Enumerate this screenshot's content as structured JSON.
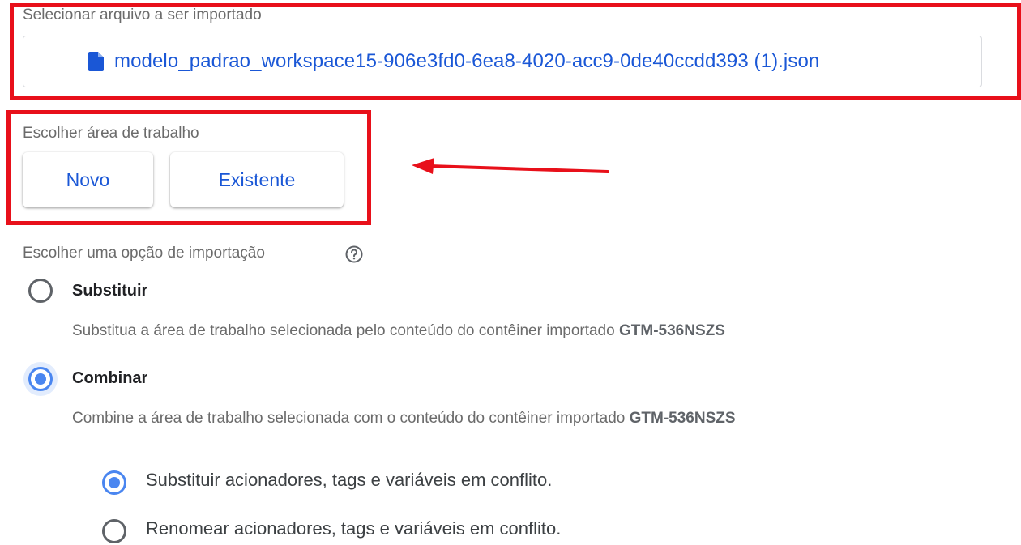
{
  "file_section": {
    "label": "Selecionar arquivo a ser importado",
    "file_name": "modelo_padrao_workspace15-906e3fd0-6ea8-4020-acc9-0de40ccdd393 (1).json",
    "icon": "file-icon"
  },
  "workspace_section": {
    "label": "Escolher área de trabalho",
    "buttons": [
      {
        "label": "Novo"
      },
      {
        "label": "Existente"
      }
    ]
  },
  "import_section": {
    "label": "Escolher uma opção de importação",
    "help_icon": "help-circle-icon",
    "options": [
      {
        "title": "Substituir",
        "description": "Substitua a área de trabalho selecionada pelo conteúdo do contêiner importado",
        "container_id": "GTM-536NSZS",
        "selected": false
      },
      {
        "title": "Combinar",
        "description": "Combine a área de trabalho selecionada com o conteúdo do contêiner importado",
        "container_id": "GTM-536NSZS",
        "selected": true
      }
    ],
    "conflict_options": [
      {
        "label": "Substituir acionadores, tags e variáveis em conflito.",
        "selected": true
      },
      {
        "label": "Renomear acionadores, tags e variáveis em conflito.",
        "selected": false
      }
    ]
  },
  "colors": {
    "accent": "#1a57d6",
    "radio_checked": "#4a86f0",
    "annotation_red": "#e8101a"
  }
}
